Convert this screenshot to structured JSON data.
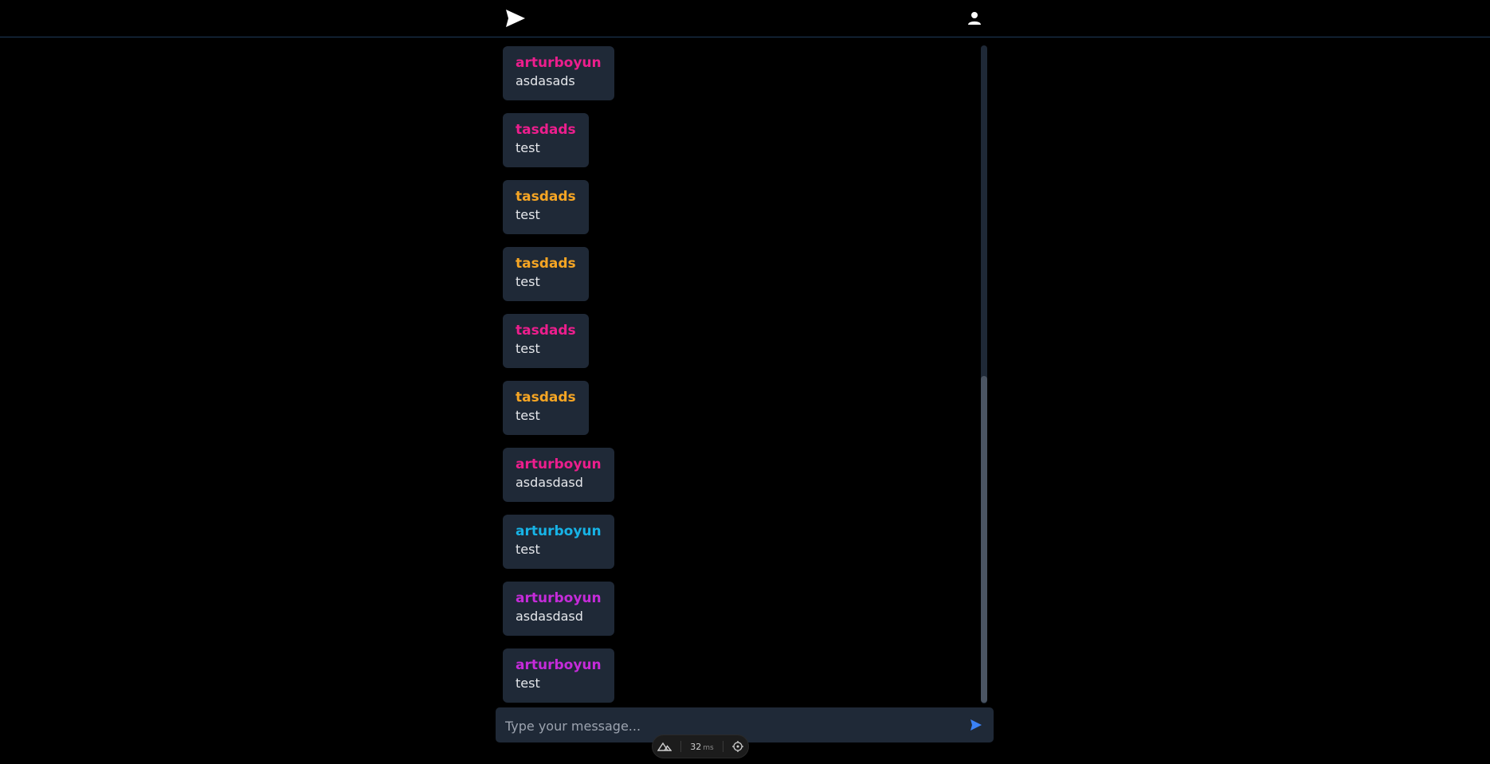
{
  "header": {
    "logo_icon": "paper-plane-icon",
    "user_icon": "user-icon"
  },
  "colors": {
    "pink": "#ec1e8d",
    "orange": "#f5a524",
    "cyan": "#17b3e6",
    "purple": "#c52bd9",
    "bubble": "#1f2937",
    "accent": "#3b82f6"
  },
  "messages": [
    {
      "user": "arturboyun",
      "text": "asdasads",
      "color": "#ec1e8d"
    },
    {
      "user": "tasdads",
      "text": "test",
      "color": "#ec1e8d"
    },
    {
      "user": "tasdads",
      "text": "test",
      "color": "#f5a524"
    },
    {
      "user": "tasdads",
      "text": "test",
      "color": "#f5a524"
    },
    {
      "user": "tasdads",
      "text": "test",
      "color": "#ec1e8d"
    },
    {
      "user": "tasdads",
      "text": "test",
      "color": "#f5a524"
    },
    {
      "user": "arturboyun",
      "text": "asdasdasd",
      "color": "#ec1e8d"
    },
    {
      "user": "arturboyun",
      "text": "test",
      "color": "#17b3e6"
    },
    {
      "user": "arturboyun",
      "text": "asdasdasd",
      "color": "#c52bd9"
    },
    {
      "user": "arturboyun",
      "text": "test",
      "color": "#c52bd9"
    }
  ],
  "composer": {
    "placeholder": "Type your message...",
    "send_icon": "send-icon"
  },
  "devtools": {
    "logo_icon": "nuxt-icon",
    "render_time": "32",
    "render_unit": "ms",
    "inspect_icon": "crosshair-icon"
  }
}
